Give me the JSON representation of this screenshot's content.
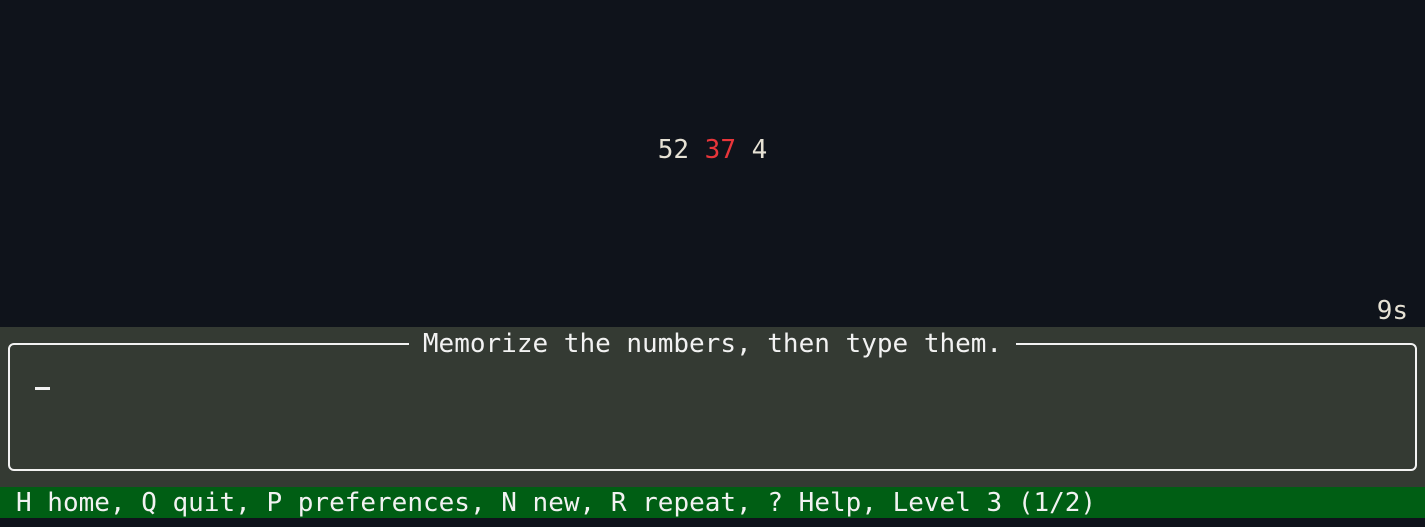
{
  "display": {
    "numbers": [
      {
        "value": "52",
        "highlight": false
      },
      {
        "value": "37",
        "highlight": true
      },
      {
        "value": "4",
        "highlight": false
      }
    ],
    "timer": "9s"
  },
  "input": {
    "title": "Memorize the numbers, then type them.",
    "value": ""
  },
  "status_bar": {
    "text": "H home, Q quit, P preferences, N new, R repeat, ? Help, Level 3 (1/2)"
  },
  "colors": {
    "background": "#0f131b",
    "panel": "#343a33",
    "highlight": "#e8353a",
    "status_bar": "#005e14"
  }
}
